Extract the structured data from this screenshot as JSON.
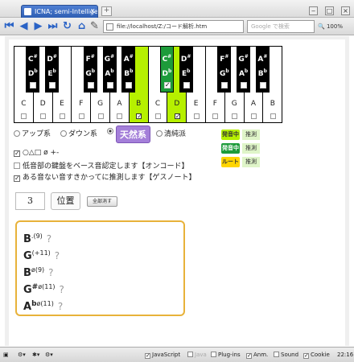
{
  "browser": {
    "tab_title": "ICNA; semi-Intellige...",
    "tab_close": "x",
    "newtab_label": "+",
    "address": "file://localhost/Z:/コード解析.htm",
    "search_placeholder": "Google で検索",
    "zoom": "100%"
  },
  "keyboard": {
    "white_keys": [
      {
        "name": "C",
        "on": false
      },
      {
        "name": "D",
        "on": false
      },
      {
        "name": "E",
        "on": false
      },
      {
        "name": "F",
        "on": false
      },
      {
        "name": "G",
        "on": false
      },
      {
        "name": "A",
        "on": false
      },
      {
        "name": "B",
        "on": true
      },
      {
        "name": "C",
        "on": false
      },
      {
        "name": "D",
        "on": true
      },
      {
        "name": "E",
        "on": false
      },
      {
        "name": "F",
        "on": false
      },
      {
        "name": "G",
        "on": false
      },
      {
        "name": "A",
        "on": false
      },
      {
        "name": "B",
        "on": false
      }
    ],
    "black_keys": [
      {
        "up": "C",
        "down": "D",
        "on": false
      },
      {
        "up": "D",
        "down": "E",
        "on": false
      },
      {
        "up": "F",
        "down": "G",
        "on": false
      },
      {
        "up": "G",
        "down": "A",
        "on": false
      },
      {
        "up": "A",
        "down": "B",
        "on": false
      },
      {
        "up": "C",
        "down": "D",
        "on": true
      },
      {
        "up": "D",
        "down": "E",
        "on": false
      },
      {
        "up": "F",
        "down": "G",
        "on": false
      },
      {
        "up": "G",
        "down": "A",
        "on": false
      },
      {
        "up": "A",
        "down": "B",
        "on": false
      }
    ],
    "sharp_symbol": "#",
    "flat_symbol": "b",
    "check_mark": "✓"
  },
  "modes": {
    "up": "アップ系",
    "down": "ダウン系",
    "natural": "天然系",
    "pure": "清純派"
  },
  "legend": [
    {
      "badge": "発音中",
      "text": "推測",
      "color": "#b6f000",
      "text_color": "#333"
    },
    {
      "badge": "発音中",
      "text": "推測",
      "color": "#1d9b3a",
      "text_color": "#fff"
    },
    {
      "badge": "ルート",
      "text": "推測",
      "color": "#ffd500",
      "text_color": "#333"
    }
  ],
  "options": {
    "symbols": "○△□ ø +-",
    "bass_root": "低音部の鍵盤をベース音認定します【オンコード】",
    "guess_note": "ある音ない音すきかってに推測します【ゲスノート】"
  },
  "inputs": {
    "number": "3",
    "position_button": "位置",
    "clear_button": "全部消す"
  },
  "chords": [
    {
      "root": "B",
      "acc": "",
      "qual": ".(9)",
      "q": "?"
    },
    {
      "root": "G",
      "acc": "",
      "qual": "(+11)",
      "q": "?"
    },
    {
      "root": "B",
      "acc": "",
      "qual": "ø(9)",
      "q": "?"
    },
    {
      "root": "G",
      "acc": "#",
      "qual": "ø(11)",
      "q": "?"
    },
    {
      "root": "A",
      "acc": "b",
      "qual": "ø(11)",
      "q": "?"
    }
  ],
  "status": {
    "javascript": "JavaScript",
    "java": "Java",
    "plugins": "Plug-ins",
    "anim": "Anm.",
    "sound": "Sound",
    "cookie": "Cookie",
    "time": "22:16"
  }
}
